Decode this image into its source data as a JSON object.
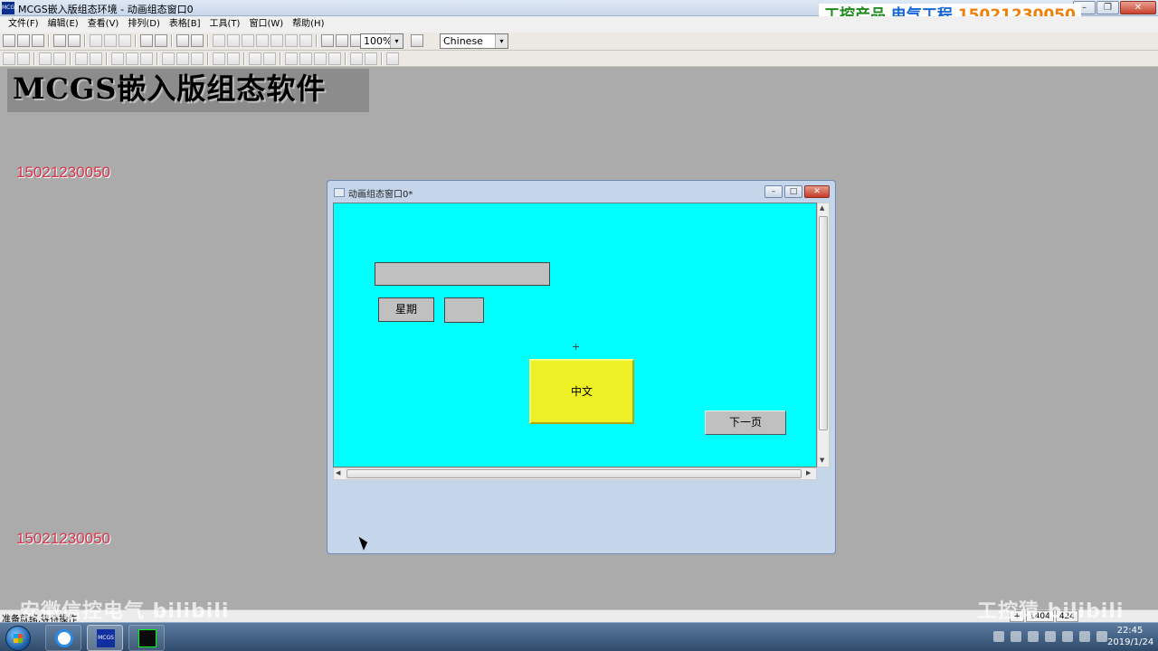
{
  "window": {
    "title": "MCGS嵌入版组态环境 - 动画组态窗口0",
    "icon_label": "MCGS",
    "minimize_glyph": "–",
    "restore_glyph": "❐",
    "close_glyph": "✕"
  },
  "overlay_ad": {
    "part1": "工控产品",
    "part2": "电气工程",
    "part3": "15021230050"
  },
  "menu": [
    "文件(F)",
    "编辑(E)",
    "查看(V)",
    "排列(D)",
    "表格[B]",
    "工具(T)",
    "窗口(W)",
    "帮助(H)"
  ],
  "toolbar": {
    "zoom_value": "100%",
    "language_value": "Chinese",
    "dropdown_glyph": "▾"
  },
  "workspace": {
    "banner": "MCGS嵌入版组态软件",
    "phone_top": "15021230050",
    "phone_bottom": "15021230050"
  },
  "child_window": {
    "title": "动画组态窗口0*",
    "minimize_glyph": "–",
    "maximize_glyph": "□",
    "close_glyph": "✕",
    "canvas": {
      "crosshair": "+",
      "week_button": "星期",
      "chinese_button": "中文",
      "next_page_button": "下一页"
    },
    "scroll_up": "▲",
    "scroll_down": "▼",
    "scroll_left": "◀",
    "scroll_right": "▶"
  },
  "statusbar": {
    "text": "准备就绪,等待操作",
    "cell1": "+",
    "cell2": "1404",
    "cell3": "424"
  },
  "watermarks": {
    "left": "安徽信控电气 bilibili",
    "right": "工控猿 bilibili"
  },
  "taskbar": {
    "mcgs_label": "MCGS",
    "time": "22:45",
    "date": "2019/1/24"
  },
  "colors": {
    "canvas_bg": "#00ffff",
    "chinese_button_bg": "#eef026",
    "workspace_bg": "#ababab",
    "phone_text": "#d8334a"
  }
}
